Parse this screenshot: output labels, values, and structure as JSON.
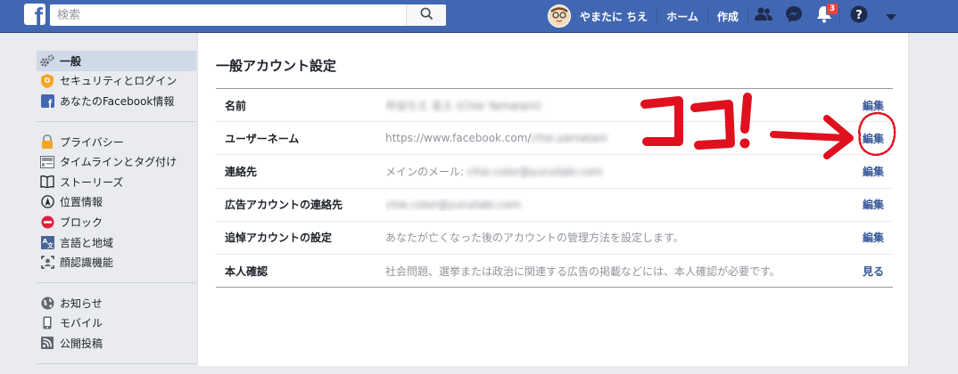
{
  "topbar": {
    "logo_letter": "f",
    "search_placeholder": "検索",
    "user_name": "やまたに ちえ",
    "home": "ホーム",
    "create": "作成",
    "notification_count": "3",
    "brand_color": "#4267b2",
    "icons": [
      "search-icon",
      "friends-icon",
      "messenger-icon",
      "bell-icon",
      "help-icon",
      "dropdown-arrow-icon"
    ]
  },
  "sidebar": {
    "groups": [
      [
        {
          "label": "一般",
          "icon": "gear-icon",
          "active": true
        },
        {
          "label": "セキュリティとログイン",
          "icon": "badge-icon"
        },
        {
          "label": "あなたのFacebook情報",
          "icon": "facebook-icon"
        }
      ],
      [
        {
          "label": "プライバシー",
          "icon": "lock-icon"
        },
        {
          "label": "タイムラインとタグ付け",
          "icon": "timeline-icon"
        },
        {
          "label": "ストーリーズ",
          "icon": "book-icon"
        },
        {
          "label": "位置情報",
          "icon": "location-icon"
        },
        {
          "label": "ブロック",
          "icon": "block-icon"
        },
        {
          "label": "言語と地域",
          "icon": "language-icon"
        },
        {
          "label": "顔認識機能",
          "icon": "face-recognition-icon"
        }
      ],
      [
        {
          "label": "お知らせ",
          "icon": "globe-icon"
        },
        {
          "label": "モバイル",
          "icon": "mobile-icon"
        },
        {
          "label": "公開投稿",
          "icon": "rss-icon"
        }
      ]
    ]
  },
  "main": {
    "title": "一般アカウント設定",
    "rows": [
      {
        "label": "名前",
        "prefix": "",
        "blurred": "中谷ちえ 名え (Chie Yamatani)",
        "action": "編集"
      },
      {
        "label": "ユーザーネーム",
        "prefix": "https://www.facebook.com/",
        "blurred": "chie.yamatani",
        "action": "編集"
      },
      {
        "label": "連絡先",
        "prefix": "メインのメール: ",
        "blurred": "chie.color@yuruilabi.com",
        "action": "編集"
      },
      {
        "label": "広告アカウントの連絡先",
        "prefix": "",
        "blurred": "chie.color@yuruilabi.com",
        "action": "編集"
      },
      {
        "label": "追悼アカウントの設定",
        "prefix": "あなたが亡くなった後のアカウントの管理方法を設定します。",
        "blurred": "",
        "action": "編集"
      },
      {
        "label": "本人確認",
        "prefix": "社会問題、選挙または政治に関連する広告の掲載などには、本人確認が必要です。",
        "blurred": "",
        "action": "見る"
      }
    ]
  },
  "annotation": {
    "text": "ココ!",
    "color": "#e0101e"
  }
}
